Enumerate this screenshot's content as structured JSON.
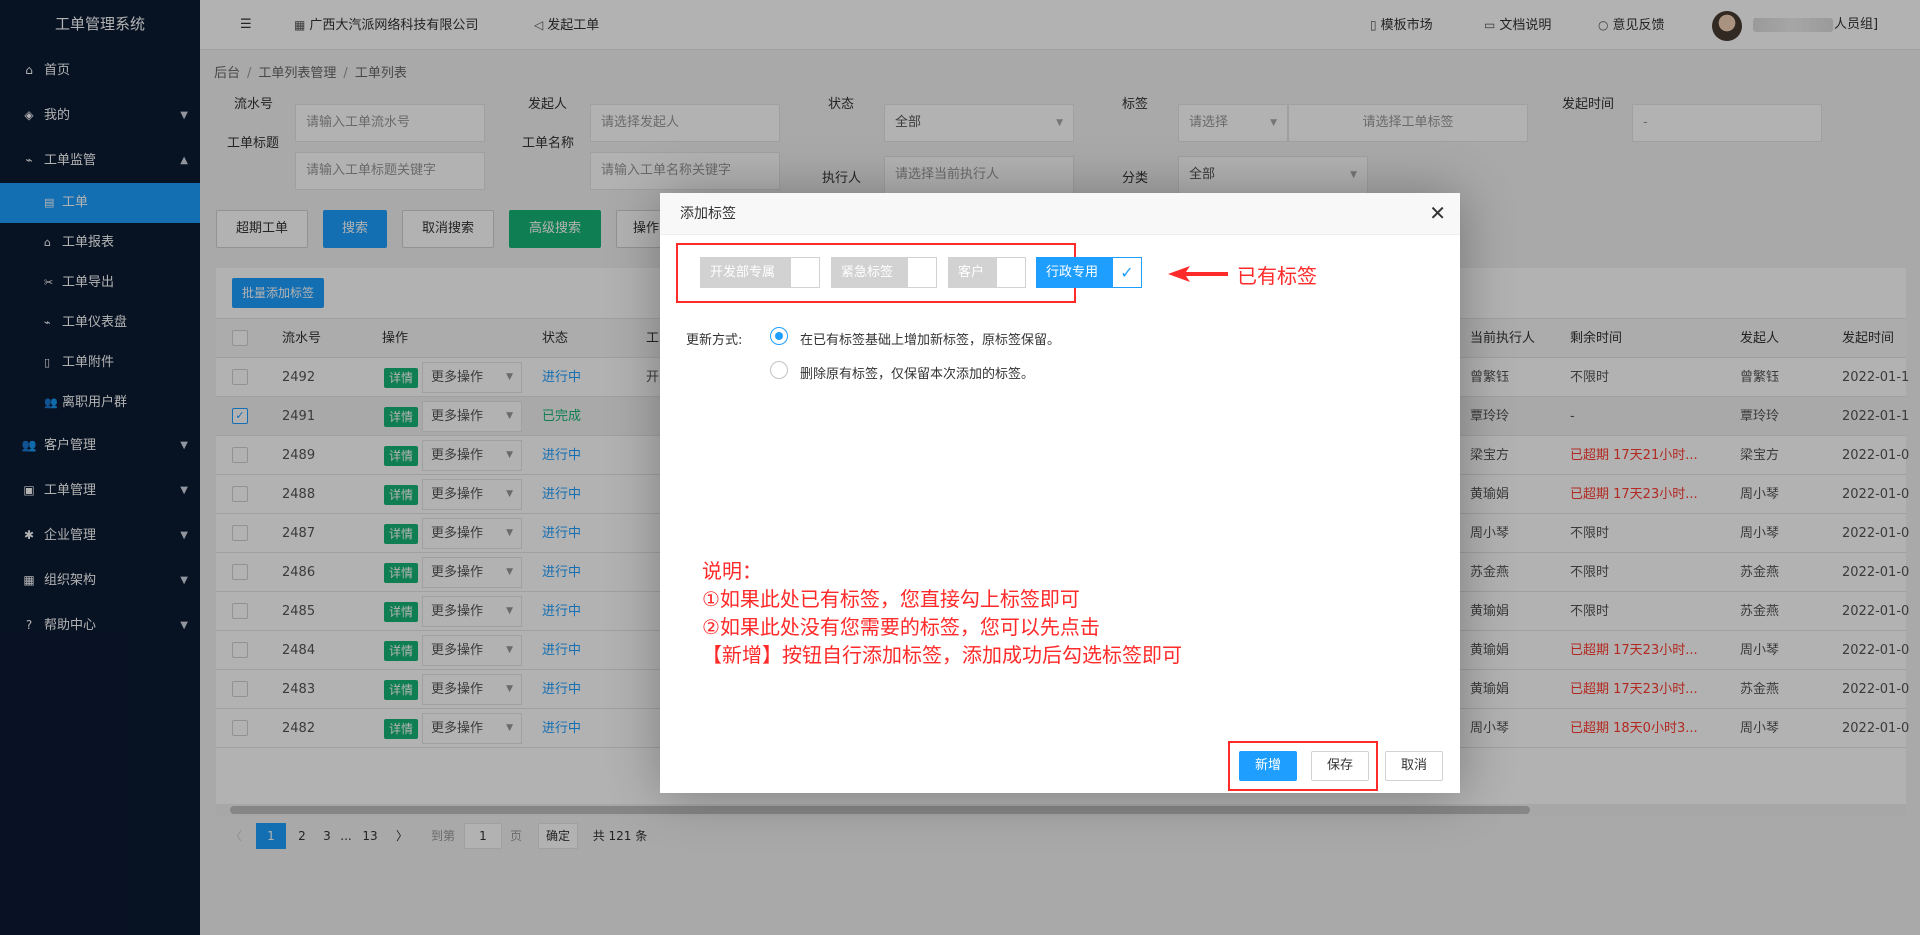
{
  "sidebar": {
    "brand": "工单管理系统",
    "items": [
      {
        "icon": "home-icon",
        "glyph": "⌂",
        "label": "首页"
      },
      {
        "icon": "layers-icon",
        "glyph": "◈",
        "label": "我的",
        "caret": "▼"
      },
      {
        "icon": "pulse-icon",
        "glyph": "⌁",
        "label": "工单监管",
        "caret": "▲"
      }
    ],
    "sub_items": [
      {
        "glyph": "▤",
        "label": "工单"
      },
      {
        "glyph": "⌂",
        "label": "工单报表"
      },
      {
        "glyph": "✂",
        "label": "工单导出"
      },
      {
        "glyph": "⌁",
        "label": "工单仪表盘"
      },
      {
        "glyph": "▯",
        "label": "工单附件"
      },
      {
        "glyph": "👥",
        "label": "离职用户群"
      }
    ],
    "items_bottom": [
      {
        "glyph": "👥",
        "label": "客户管理",
        "caret": "▼"
      },
      {
        "glyph": "▣",
        "label": "工单管理",
        "caret": "▼"
      },
      {
        "glyph": "✱",
        "label": "企业管理",
        "caret": "▼"
      },
      {
        "glyph": "▦",
        "label": "组织架构",
        "caret": "▼"
      },
      {
        "glyph": "?",
        "label": "帮助中心",
        "caret": "▼"
      }
    ]
  },
  "header": {
    "menu_glyph": "☰",
    "company": "广西大汽派网络科技有限公司",
    "company_glyph": "▦",
    "start_ticket": "发起工单",
    "start_glyph": "◁",
    "template_market": "模板市场",
    "template_glyph": "▯",
    "docs": "文档说明",
    "docs_glyph": "▭",
    "feedback": "意见反馈",
    "feedback_glyph": "○",
    "user_suffix": "人员组]",
    "user_prefix": "["
  },
  "breadcrumb": {
    "a": "后台",
    "b": "工单列表管理",
    "c": "工单列表",
    "sep": "/"
  },
  "filters": {
    "serial_label": "流水号",
    "serial_ph": "请输入工单流水号",
    "initiator_label": "发起人",
    "initiator_ph": "请选择发起人",
    "status_label": "状态",
    "status_val": "全部",
    "tag_label": "标签",
    "tag_select": "请选择",
    "tag_ph": "请选择工单标签",
    "time_label": "发起时间",
    "time_val": "-",
    "title_label": "工单标题",
    "title_ph": "请输入工单标题关键字",
    "name_label": "工单名称",
    "name_ph": "请输入工单名称关键字",
    "executor_label": "执行人",
    "executor_ph": "请选择当前执行人",
    "category_label": "分类",
    "category_val": "全部",
    "dd": "▼"
  },
  "actions": {
    "overdue": "超期工单",
    "search": "搜索",
    "cancel_search": "取消搜索",
    "advanced": "高级搜索",
    "ops": "操作"
  },
  "table": {
    "batch_tag": "批量添加标签",
    "headers": {
      "serial": "流水号",
      "op": "操作",
      "status": "状态",
      "col4": "工",
      "executor": "当前执行人",
      "remain": "剩余时间",
      "initiator": "发起人",
      "time": "发起时间"
    },
    "detail": "详情",
    "more": "更多操作",
    "dd": "▼",
    "check": "✓",
    "rows": [
      {
        "id": "2492",
        "status": "进行中",
        "done": false,
        "col4": "开",
        "executor": "曾繁钰",
        "remain": "不限时",
        "overdue": false,
        "initiator": "曾繁钰",
        "time": "2022-01-1",
        "sel": false
      },
      {
        "id": "2491",
        "status": "已完成",
        "done": true,
        "col4": "",
        "executor": "覃玲玲",
        "remain": "-",
        "overdue": false,
        "initiator": "覃玲玲",
        "time": "2022-01-1",
        "sel": true
      },
      {
        "id": "2489",
        "status": "进行中",
        "done": false,
        "col4": "",
        "executor": "梁宝方",
        "remain": "已超期 17天21小时...",
        "overdue": true,
        "initiator": "梁宝方",
        "time": "2022-01-0",
        "sel": false
      },
      {
        "id": "2488",
        "status": "进行中",
        "done": false,
        "col4": "",
        "executor": "黄瑜娟",
        "remain": "已超期 17天23小时...",
        "overdue": true,
        "initiator": "周小琴",
        "time": "2022-01-0",
        "sel": false
      },
      {
        "id": "2487",
        "status": "进行中",
        "done": false,
        "col4": "",
        "executor": "周小琴",
        "remain": "不限时",
        "overdue": false,
        "initiator": "周小琴",
        "time": "2022-01-0",
        "sel": false
      },
      {
        "id": "2486",
        "status": "进行中",
        "done": false,
        "col4": "",
        "executor": "苏金燕",
        "remain": "不限时",
        "overdue": false,
        "initiator": "苏金燕",
        "time": "2022-01-0",
        "sel": false
      },
      {
        "id": "2485",
        "status": "进行中",
        "done": false,
        "col4": "",
        "executor": "黄瑜娟",
        "remain": "不限时",
        "overdue": false,
        "initiator": "苏金燕",
        "time": "2022-01-0",
        "sel": false
      },
      {
        "id": "2484",
        "status": "进行中",
        "done": false,
        "col4": "",
        "executor": "黄瑜娟",
        "remain": "已超期 17天23小时...",
        "overdue": true,
        "initiator": "周小琴",
        "time": "2022-01-0",
        "sel": false
      },
      {
        "id": "2483",
        "status": "进行中",
        "done": false,
        "col4": "",
        "executor": "黄瑜娟",
        "remain": "已超期 17天23小时...",
        "overdue": true,
        "initiator": "苏金燕",
        "time": "2022-01-0",
        "sel": false
      },
      {
        "id": "2482",
        "status": "进行中",
        "done": false,
        "col4": "",
        "executor": "周小琴",
        "remain": "已超期 18天0小时3...",
        "overdue": true,
        "initiator": "周小琴",
        "time": "2022-01-0",
        "sel": false
      }
    ]
  },
  "pager": {
    "prev": "〈",
    "next": "〉",
    "p1": "1",
    "p2": "2",
    "p3": "3",
    "ellipsis": "...",
    "last": "13",
    "goto": "到第",
    "page_val": "1",
    "page_unit": "页",
    "confirm": "确定",
    "total": "共 121 条"
  },
  "modal": {
    "title": "添加标签",
    "close": "✕",
    "tags": [
      {
        "name": "开发部专属",
        "checked": false
      },
      {
        "name": "紧急标签",
        "checked": false
      },
      {
        "name": "客户",
        "checked": false
      },
      {
        "name": "行政专用",
        "checked": true
      }
    ],
    "check_glyph": "✓",
    "mode_label": "更新方式:",
    "mode_opt1": "在已有标签基础上增加新标签，原标签保留。",
    "mode_opt2": "删除原有标签，仅保留本次添加的标签。",
    "note": [
      "说明：",
      "①如果此处已有标签，您直接勾上标签即可",
      "②如果此处没有您需要的标签，您可以先点击",
      "【新增】按钮自行添加标签，添加成功后勾选标签即可"
    ],
    "btn_add": "新增",
    "btn_save": "保存",
    "btn_cancel": "取消"
  },
  "annotation": {
    "existing_tags": "已有标签"
  },
  "colors": {
    "sidebar": "#0b1a33",
    "accent": "#1e9fff",
    "green": "#16b777",
    "annotation": "#ff2a2a"
  }
}
